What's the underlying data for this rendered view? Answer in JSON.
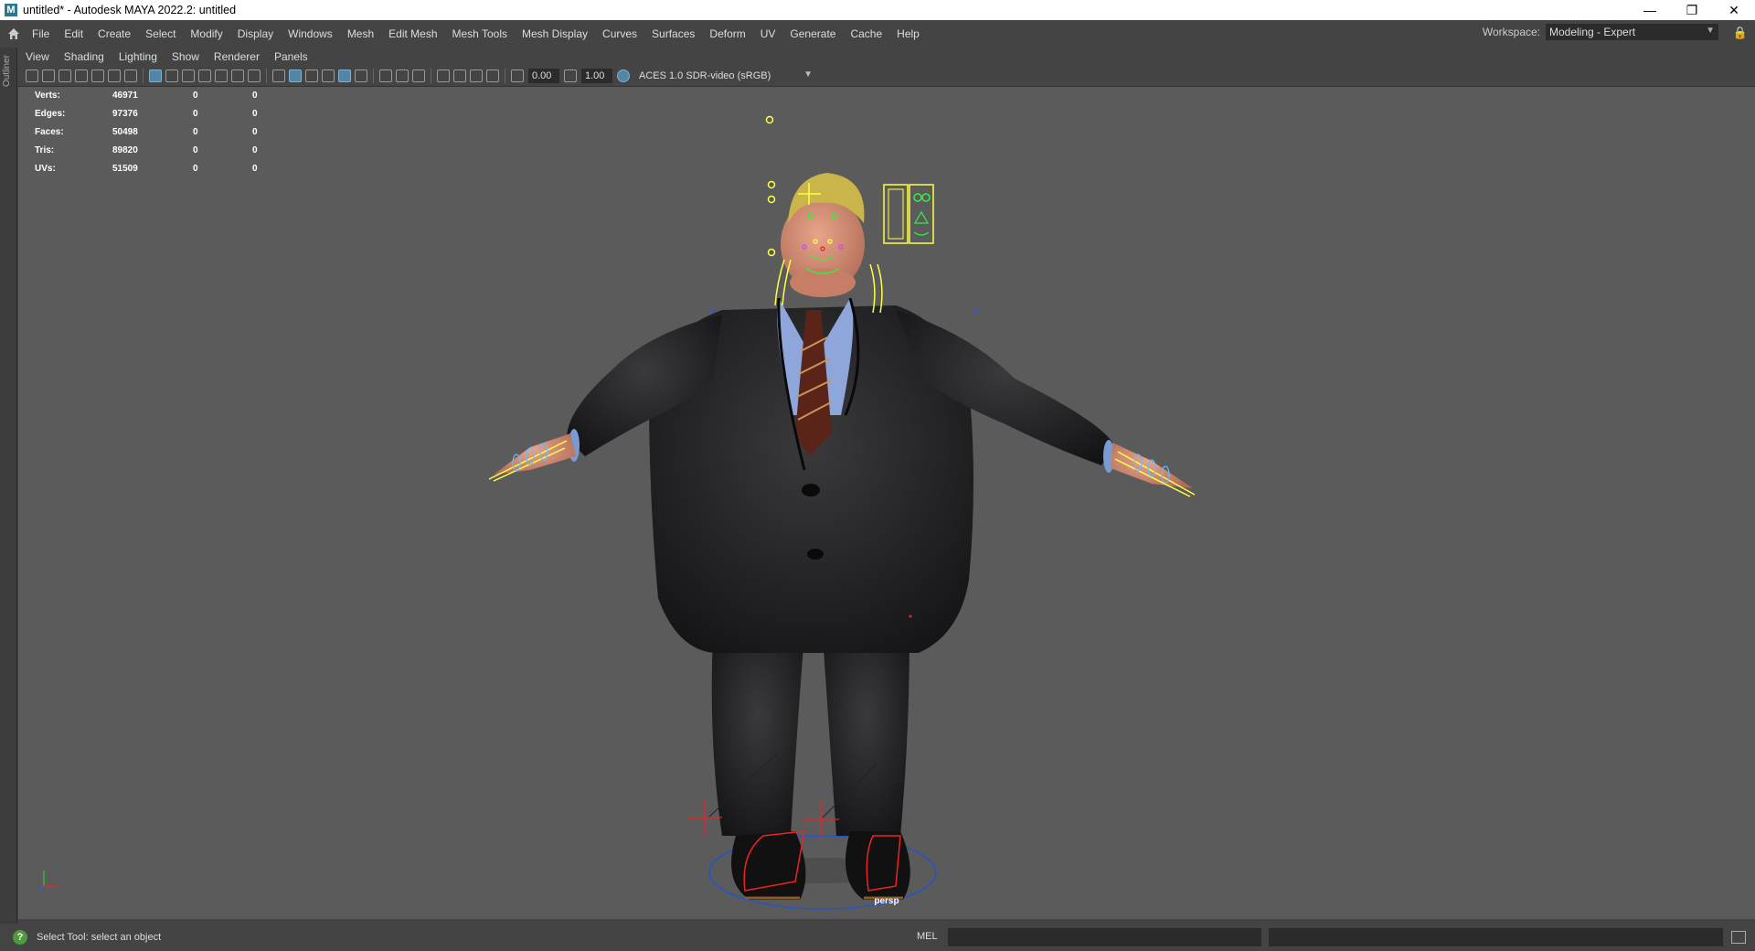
{
  "window": {
    "title": "untitled* - Autodesk MAYA 2022.2: untitled",
    "app_icon": "M"
  },
  "menu": [
    "File",
    "Edit",
    "Create",
    "Select",
    "Modify",
    "Display",
    "Windows",
    "Mesh",
    "Edit Mesh",
    "Mesh Tools",
    "Mesh Display",
    "Curves",
    "Surfaces",
    "Deform",
    "UV",
    "Generate",
    "Cache",
    "Help"
  ],
  "workspace": {
    "label": "Workspace:",
    "value": "Modeling - Expert"
  },
  "outliner_tab": "Outliner",
  "panel_menu": [
    "View",
    "Shading",
    "Lighting",
    "Show",
    "Renderer",
    "Panels"
  ],
  "panel_toolbar": {
    "exposure": "0.00",
    "gamma": "1.00",
    "color_space": "ACES 1.0 SDR-video (sRGB)"
  },
  "hud": [
    {
      "label": "Verts:",
      "a": "46971",
      "b": "0",
      "c": "0"
    },
    {
      "label": "Edges:",
      "a": "97376",
      "b": "0",
      "c": "0"
    },
    {
      "label": "Faces:",
      "a": "50498",
      "b": "0",
      "c": "0"
    },
    {
      "label": "Tris:",
      "a": "89820",
      "b": "0",
      "c": "0"
    },
    {
      "label": "UVs:",
      "a": "51509",
      "b": "0",
      "c": "0"
    }
  ],
  "camera_name": "persp",
  "status": {
    "help_text": "Select Tool: select an object",
    "command_lang": "MEL"
  },
  "colors": {
    "viewport_bg": "#5b5b5b",
    "ui_bg": "#444444",
    "rig_yellow": "#ffff44",
    "rig_red": "#ee2222",
    "rig_blue": "#2255cc",
    "selected_tool": "#5285a6"
  }
}
